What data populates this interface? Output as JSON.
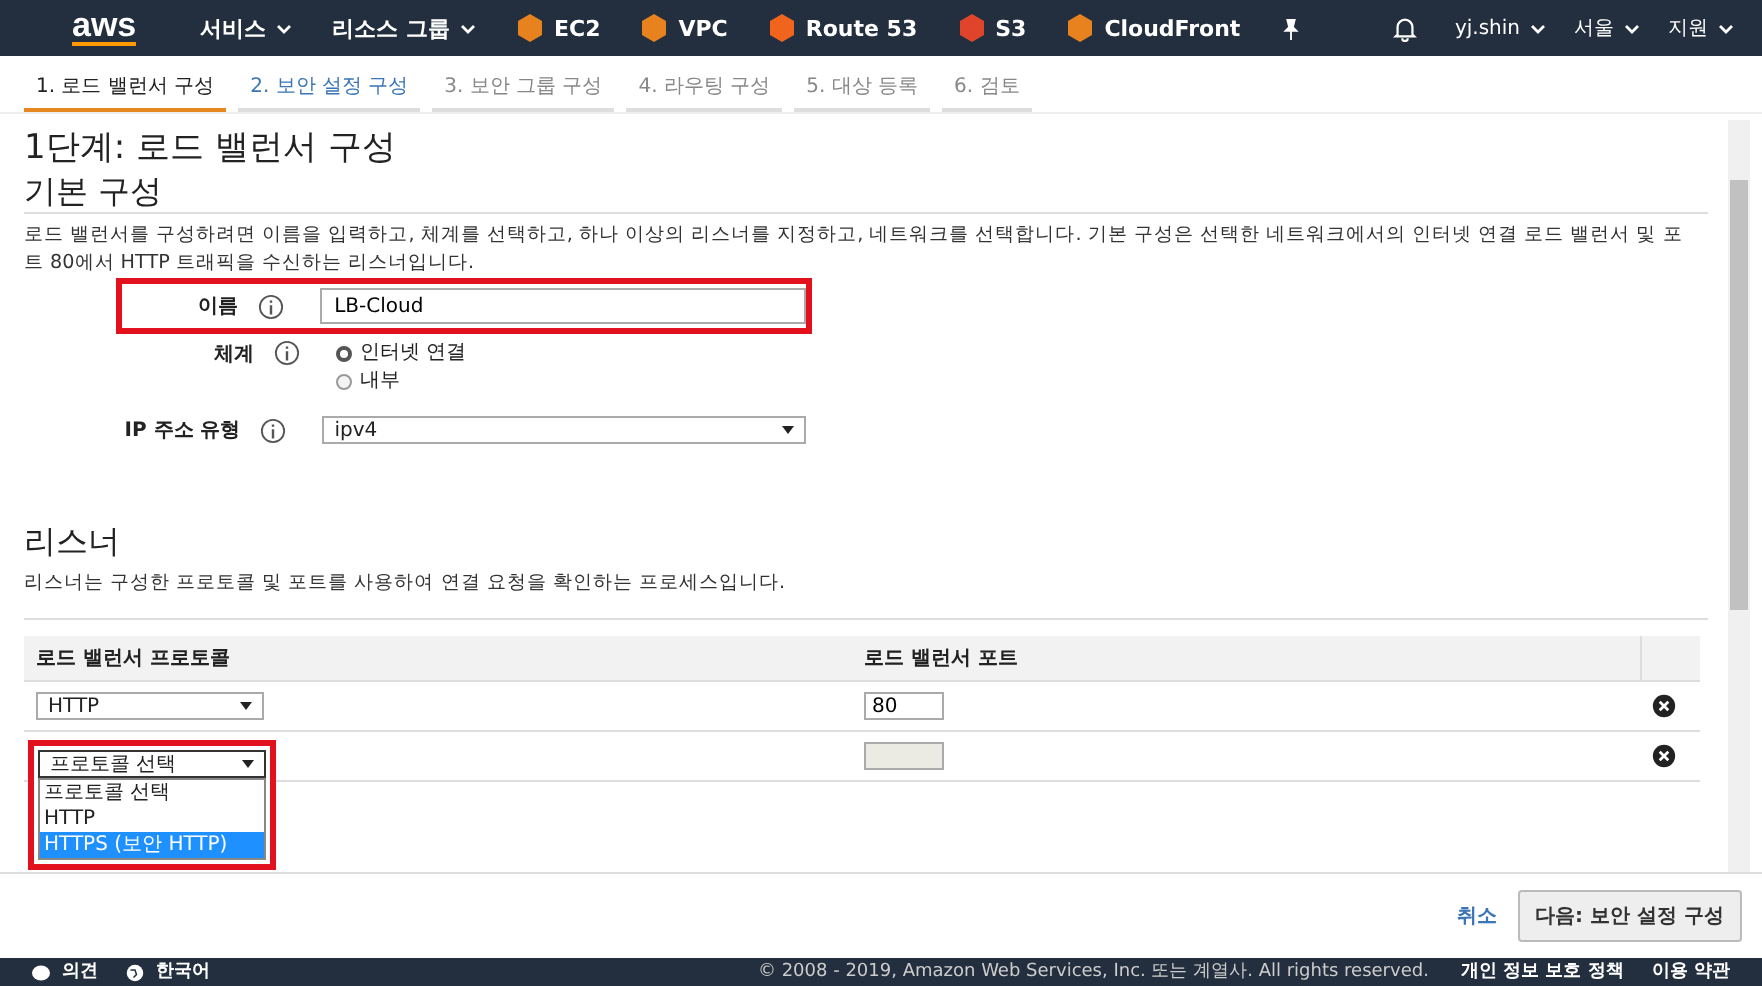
{
  "nav": {
    "logo": "aws",
    "menus": [
      {
        "label": "서비스"
      },
      {
        "label": "리소스 그룹"
      }
    ],
    "shortcuts": [
      {
        "label": "EC2",
        "color": "#e8821e"
      },
      {
        "label": "VPC",
        "color": "#e8821e"
      },
      {
        "label": "Route 53",
        "color": "#f0641e"
      },
      {
        "label": "S3",
        "color": "#e0452c"
      },
      {
        "label": "CloudFront",
        "color": "#e8821e"
      }
    ],
    "user": "yj.shin",
    "region": "서울",
    "support": "지원"
  },
  "steps": [
    {
      "label": "1. 로드 밸런서 구성",
      "selected": true,
      "disabled": false
    },
    {
      "label": "2. 보안 설정 구성",
      "selected": false,
      "disabled": false
    },
    {
      "label": "3. 보안 그룹 구성",
      "selected": false,
      "disabled": true
    },
    {
      "label": "4. 라우팅 구성",
      "selected": false,
      "disabled": true
    },
    {
      "label": "5. 대상 등록",
      "selected": false,
      "disabled": true
    },
    {
      "label": "6. 검토",
      "selected": false,
      "disabled": true
    }
  ],
  "page_title": "1단계: 로드 밸런서 구성",
  "basic": {
    "heading": "기본 구성",
    "description": "로드 밸런서를 구성하려면 이름을 입력하고, 체계를 선택하고, 하나 이상의 리스너를 지정하고, 네트워크를 선택합니다. 기본 구성은 선택한 네트워크에서의 인터넷 연결 로드 밸런서 및 포트 80에서 HTTP 트래픽을 수신하는 리스너입니다.",
    "name": {
      "label": "이름",
      "value": "LB-Cloud",
      "highlighted": true
    },
    "scheme": {
      "label": "체계",
      "options": [
        {
          "label": "인터넷 연결",
          "selected": true
        },
        {
          "label": "내부",
          "selected": false
        }
      ]
    },
    "ip_type": {
      "label": "IP 주소 유형",
      "value": "ipv4"
    }
  },
  "listeners": {
    "heading": "리스너",
    "description": "리스너는 구성한 프로토콜 및 포트를 사용하여 연결 요청을 확인하는 프로세스입니다.",
    "columns": [
      "로드 밸런서 프로토콜",
      "로드 밸런서 포트"
    ],
    "rows": [
      {
        "protocol": "HTTP",
        "port": "80",
        "disabled": false,
        "open": false
      },
      {
        "protocol": "프로토콜 선택",
        "port": "",
        "disabled": true,
        "open": true
      }
    ],
    "dropdown": {
      "highlighted": true,
      "options": [
        {
          "label": "프로토콜 선택",
          "selected": false
        },
        {
          "label": "HTTP",
          "selected": false
        },
        {
          "label": "HTTPS (보안 HTTP)",
          "selected": true
        }
      ]
    }
  },
  "buttons": {
    "cancel": "취소",
    "next": "다음: 보안 설정 구성"
  },
  "footer": {
    "feedback": "의견",
    "language": "한국어",
    "copyright": "© 2008 - 2019, Amazon Web Services, Inc. 또는 계열사. All rights reserved.",
    "privacy": "개인 정보 보호 정책",
    "terms": "이용 약관"
  }
}
